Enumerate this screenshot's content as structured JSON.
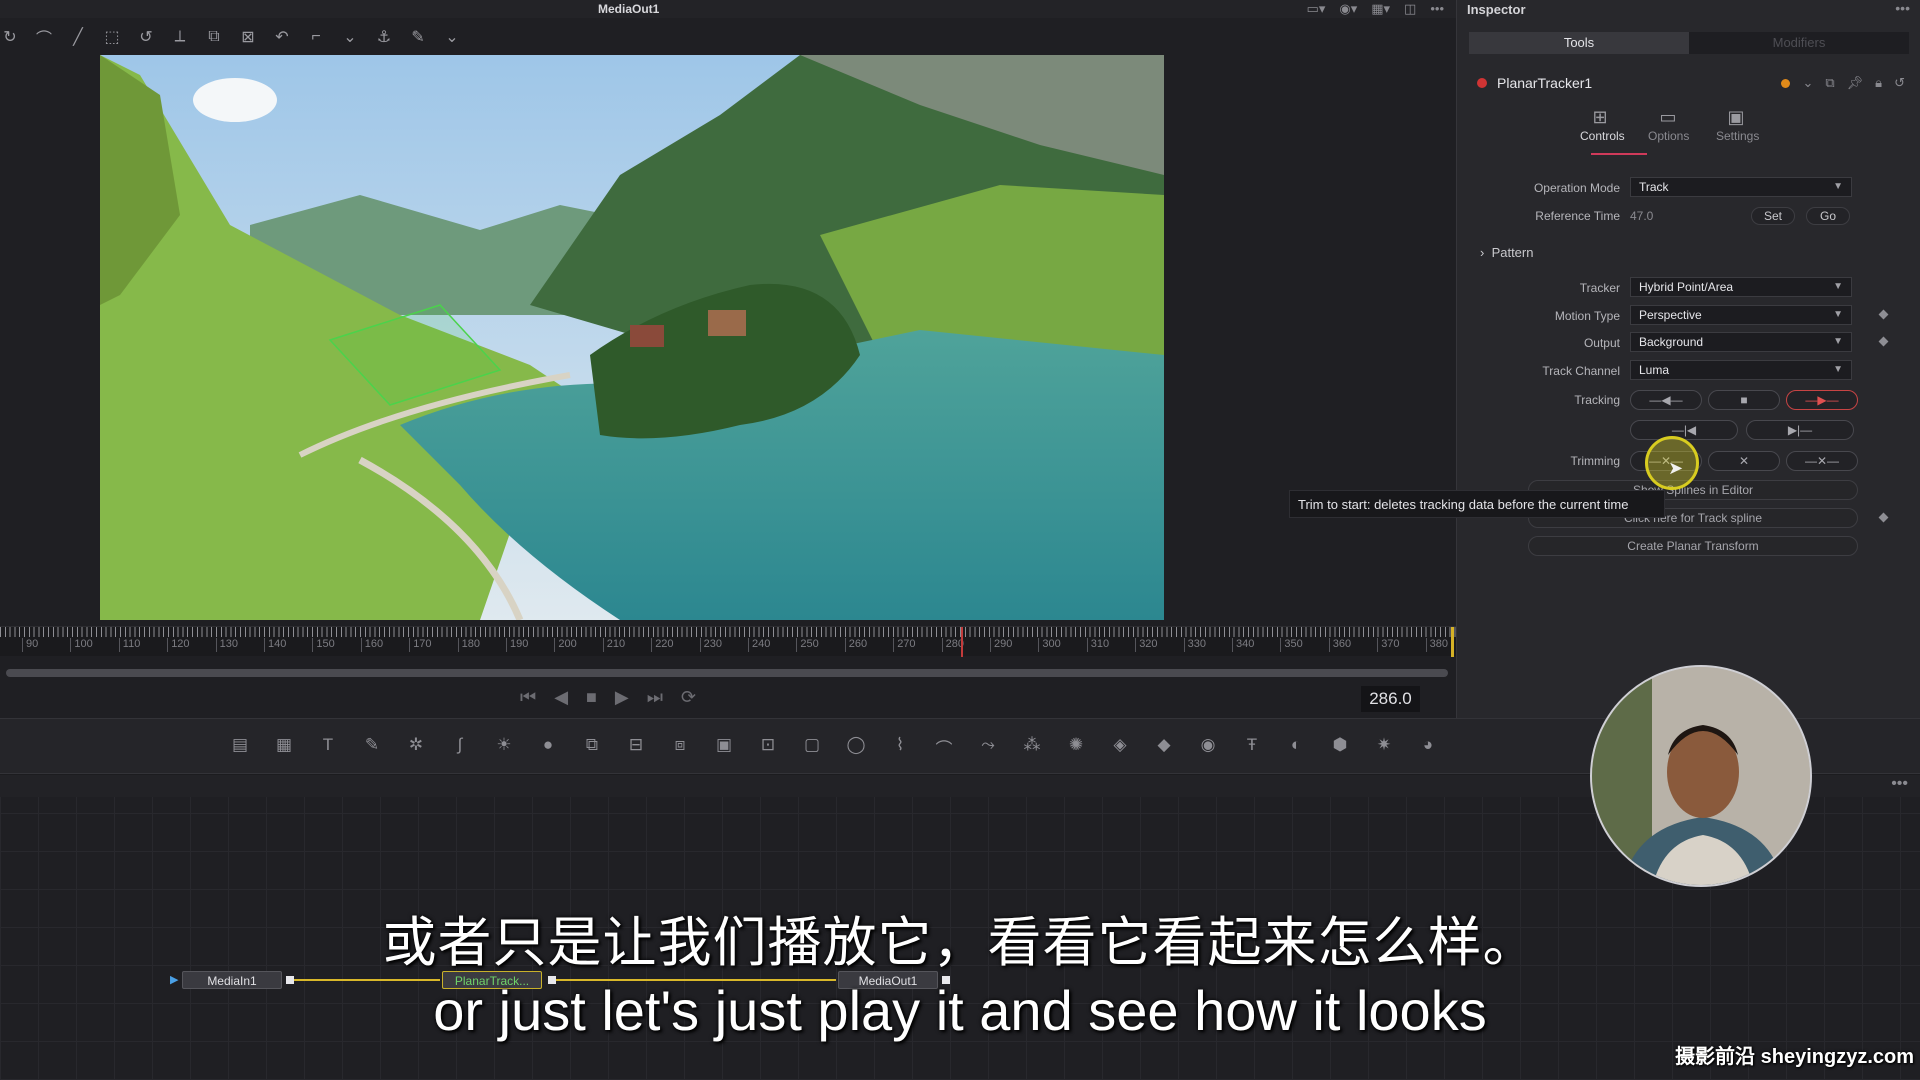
{
  "viewer": {
    "title": "MediaOut1",
    "toolbar_right_icons": [
      "viewer-layout-icon",
      "color-icon",
      "grid-icon",
      "split-icon",
      "more-icon"
    ],
    "timecode": "286.0",
    "ruler_labels": [
      "90",
      "100",
      "110",
      "120",
      "130",
      "140",
      "150",
      "160",
      "170",
      "180",
      "190",
      "200",
      "210",
      "220",
      "230",
      "240",
      "250",
      "260",
      "270",
      "280",
      "290",
      "300",
      "310",
      "320",
      "330",
      "340",
      "350",
      "360",
      "370",
      "380"
    ]
  },
  "inspector": {
    "title": "Inspector",
    "tabs": [
      "Tools",
      "Modifiers"
    ],
    "tool_name": "PlanarTracker1",
    "subtabs": [
      "Controls",
      "Options",
      "Settings"
    ],
    "operation_mode": {
      "label": "Operation Mode",
      "value": "Track"
    },
    "reference_time": {
      "label": "Reference Time",
      "value": "47.0",
      "set": "Set",
      "go": "Go"
    },
    "pattern_section": "Pattern",
    "tracker": {
      "label": "Tracker",
      "value": "Hybrid Point/Area"
    },
    "motion_type": {
      "label": "Motion Type",
      "value": "Perspective"
    },
    "output": {
      "label": "Output",
      "value": "Background"
    },
    "track_channel": {
      "label": "Track Channel",
      "value": "Luma"
    },
    "tracking_label": "Tracking",
    "trimming_label": "Trimming",
    "show_splines": "Show Splines in Editor",
    "track_spline": "Click here for Track spline",
    "create_planar": "Create Planar Transform",
    "tooltip": "Trim to start:  deletes tracking data before the current time"
  },
  "nodes": {
    "media_in": "MediaIn1",
    "planar": "PlanarTrack...",
    "media_out": "MediaOut1"
  },
  "subtitles": {
    "zh": "或者只是让我们播放它，看看它看起来怎么样。",
    "en": "or just let's just play it and see how it looks"
  },
  "watermark": "摄影前沿 sheyingzyz.com",
  "colors": {
    "accent_red": "#d03434",
    "wire_yellow": "#d9b82a",
    "node_green_text": "#6fd36a"
  }
}
